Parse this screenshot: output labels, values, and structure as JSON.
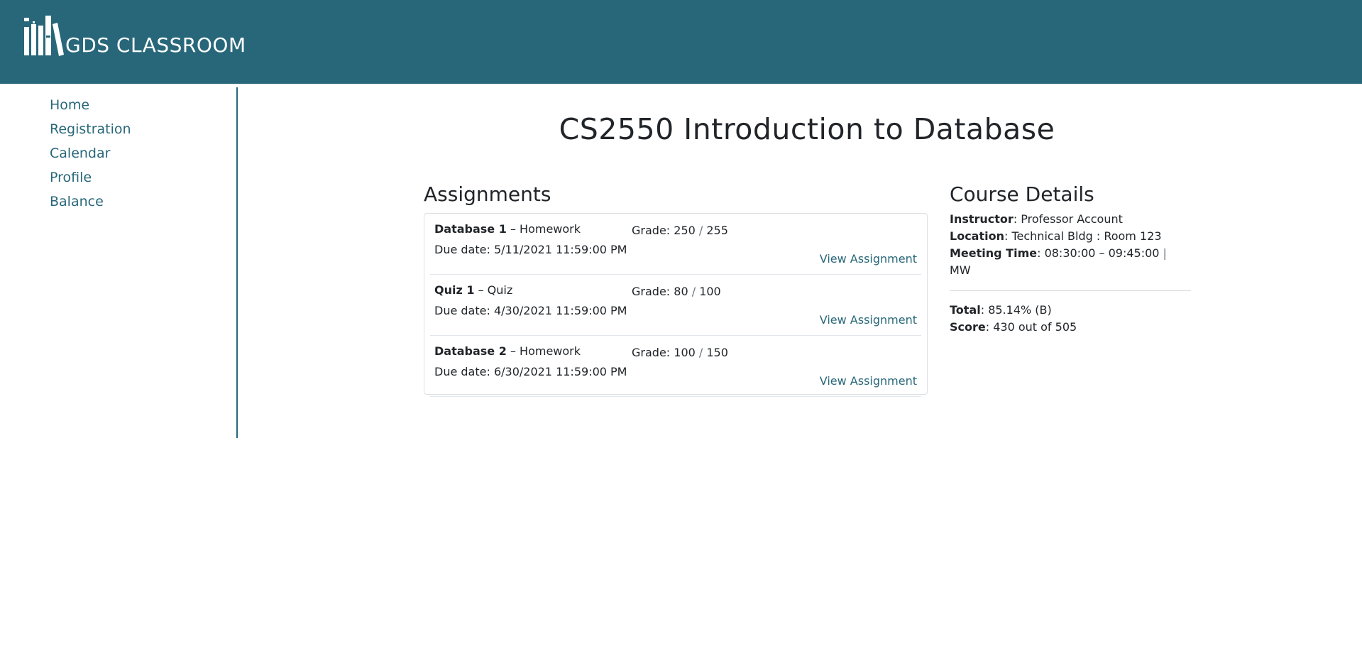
{
  "brand": {
    "logo_text": "GDS CLASSROOM",
    "header_color": "#286779",
    "logo_icon": "books-icon"
  },
  "nav": {
    "items": [
      {
        "label": "Home"
      },
      {
        "label": "Registration"
      },
      {
        "label": "Calendar"
      },
      {
        "label": "Profile"
      },
      {
        "label": "Balance"
      }
    ]
  },
  "course": {
    "title": "CS2550 Introduction to Database"
  },
  "assignments": {
    "heading": "Assignments",
    "items": [
      {
        "name": "Database 1",
        "type_sep": " – ",
        "type": "Homework",
        "grade_label": "Grade: ",
        "grade_value": "250",
        "grade_sep": " / ",
        "grade_max": "255",
        "due": "Due date: 5/11/2021 11:59:00 PM",
        "link": "View Assignment"
      },
      {
        "name": "Quiz 1",
        "type_sep": " – ",
        "type": "Quiz",
        "grade_label": "Grade: ",
        "grade_value": "80",
        "grade_sep": " / ",
        "grade_max": "100",
        "due": "Due date: 4/30/2021 11:59:00 PM",
        "link": "View Assignment"
      },
      {
        "name": "Database 2",
        "type_sep": " – ",
        "type": "Homework",
        "grade_label": "Grade: ",
        "grade_value": "100",
        "grade_sep": " / ",
        "grade_max": "150",
        "due": "Due date: 6/30/2021 11:59:00 PM",
        "link": "View Assignment"
      }
    ]
  },
  "details": {
    "heading": "Course Details",
    "instructor_label": "Instructor",
    "instructor": ": Professor Account",
    "location_label": "Location",
    "location": ": Technical Bldg : Room 123",
    "meeting_label": "Meeting Time",
    "meeting": ": 08:30:00 – 09:45:00 ",
    "meeting_sep": "|",
    "meeting_days": " MW",
    "total_label": "Total",
    "total": ": 85.14% (B)",
    "score_label": "Score",
    "score": ": 430 out of 505"
  }
}
